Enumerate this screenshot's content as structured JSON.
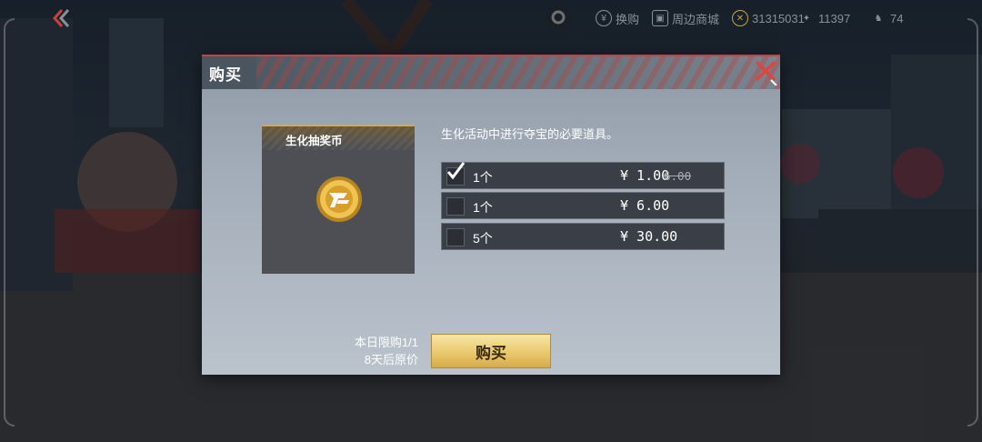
{
  "topbar": {
    "exchange_label": "换购",
    "mall_label": "周边商城",
    "currency1": "31315031",
    "currency2": "11397",
    "player_count": "74"
  },
  "dialog": {
    "title": "购买",
    "item_name": "生化抽奖币",
    "description": "生化活动中进行夺宝的必要道具。",
    "options": [
      {
        "qty": "1个",
        "price": "¥ 1.00",
        "original_price": "6.00",
        "selected": true
      },
      {
        "qty": "1个",
        "price": "¥ 6.00",
        "selected": false
      },
      {
        "qty": "5个",
        "price": "¥ 30.00",
        "selected": false
      }
    ],
    "limit_line1": "本日限购1/1",
    "limit_line2": "8天后原价",
    "buy_label": "购买"
  },
  "colors": {
    "accent_red": "#c9403c",
    "button_gold": "#e9c96e",
    "coin_gold": "#e7b63a"
  },
  "icons": [
    "back-chevron-icon",
    "settings-icon",
    "exchange-icon",
    "mall-icon",
    "coin-icon",
    "player-icon",
    "close-icon",
    "checkmark-icon"
  ]
}
